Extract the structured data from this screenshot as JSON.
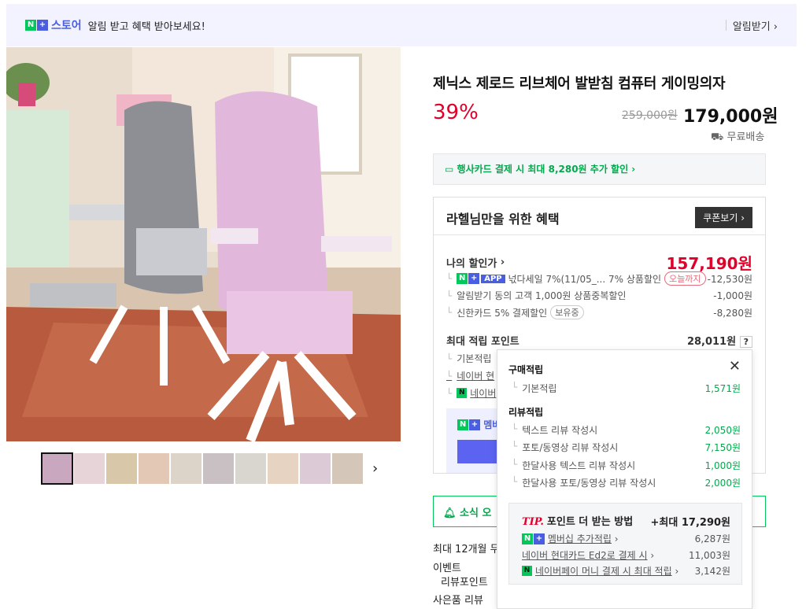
{
  "topbar": {
    "store_name": "스토어",
    "message": "알림 받고 혜택 받아보세요!",
    "alert_button": "알림받기"
  },
  "product": {
    "title": "제닉스 제로드 리브체어 발받침 컴퓨터 게이밍의자",
    "discount": "39%",
    "original_price": "259,000원",
    "price": "179,000원",
    "shipping": "무료배송",
    "card_promo": "행사카드 결제 시 최대 8,280원 추가 할인"
  },
  "benefit": {
    "title": "라헬님만을 위한 혜택",
    "coupon_button": "쿠폰보기",
    "my_discount_label": "나의 할인가",
    "my_discount_value": "157,190원",
    "rows": [
      {
        "label": "넋다세일 7%(11/05_...",
        "extra": "7% 상품할인",
        "tag": "오늘까지",
        "value": "-12,530원"
      },
      {
        "label": "알림받기 동의 고객 1,000원 상품중복할인",
        "value": "-1,000원"
      },
      {
        "label": "신한카드 5% 결제할인",
        "tag": "보유중",
        "value": "-8,280원"
      }
    ],
    "max_points_label": "최대 적립 포인트",
    "max_points_value": "28,011원",
    "help": "?",
    "point_rows": [
      "기본적립",
      "네이버 현",
      "네이버"
    ],
    "member_label": "멤버"
  },
  "notify": "소식 오",
  "below": {
    "line1": "최대 12개월 무",
    "line2": "이벤트",
    "line3": "리뷰포인트",
    "line4": "사은품  리뷰"
  },
  "popup": {
    "purchase_title": "구매적립",
    "purchase_rows": [
      {
        "label": "기본적립",
        "value": "1,571원"
      }
    ],
    "review_title": "리뷰적립",
    "review_rows": [
      {
        "label": "텍스트 리뷰 작성시",
        "value": "2,050원"
      },
      {
        "label": "포토/동영상 리뷰 작성시",
        "value": "7,150원"
      },
      {
        "label": "한달사용 텍스트 리뷰 작성시",
        "value": "1,000원"
      },
      {
        "label": "한달사용 포토/동영상 리뷰 작성시",
        "value": "2,000원"
      }
    ],
    "tip_label": "TIP.",
    "tip_title": "포인트 더 받는 방법",
    "tip_total": "+최대 17,290원",
    "tip_rows": [
      {
        "label": "멤버십 추가적립",
        "value": "6,287원"
      },
      {
        "label": "네이버 현대카드 Ed2로 결제 시",
        "value": "11,003원"
      },
      {
        "label": "네이버페이 머니 결제 시 최대 적립",
        "value": "3,142원"
      }
    ]
  },
  "colors": {
    "accent": "#4a5fe0",
    "naver_green": "#03c75a",
    "discount_red": "#e0002a"
  }
}
